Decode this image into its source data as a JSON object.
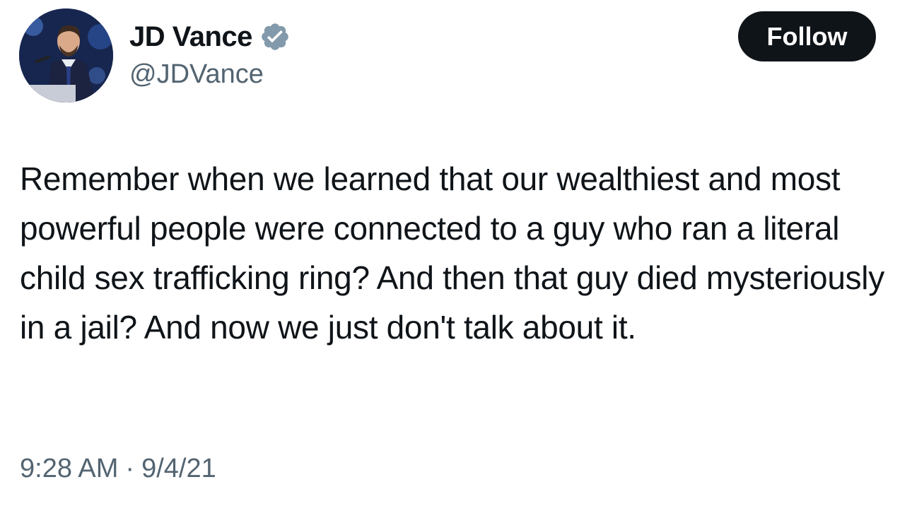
{
  "author": {
    "display_name": "JD Vance",
    "handle": "@JDVance",
    "verified_icon": "verified-badge-icon",
    "avatar": "profile-photo"
  },
  "actions": {
    "follow_label": "Follow"
  },
  "tweet": {
    "text": "Remember when we learned that our wealthiest and most powerful people were connected to a guy who ran a literal child sex trafficking ring? And then that guy died mysteriously in a jail? And now we just don't talk about it.",
    "time": "9:28 AM",
    "separator": "·",
    "date": "9/4/21"
  },
  "colors": {
    "text_primary": "#0f1419",
    "text_secondary": "#536471",
    "verified_badge": "#829aab",
    "follow_button_bg": "#0f1419",
    "follow_button_text": "#ffffff"
  }
}
